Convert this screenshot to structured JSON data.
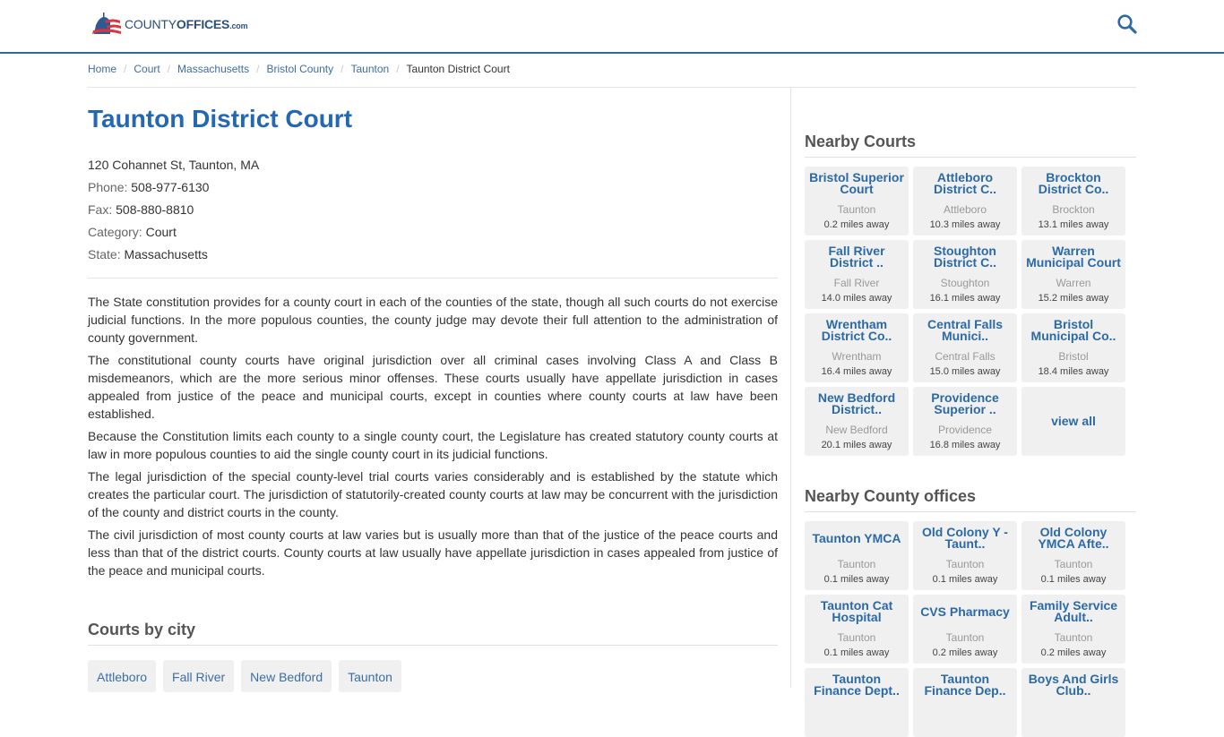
{
  "header": {
    "logo": {
      "county": "COUNTY",
      "offices": "OFFICES",
      "tld": ".com"
    },
    "search_icon": "search-icon"
  },
  "breadcrumb": {
    "items": [
      "Home",
      "Court",
      "Massachusetts",
      "Bristol County",
      "Taunton"
    ],
    "separator": "/",
    "current": "Taunton District Court"
  },
  "page": {
    "title": "Taunton District Court",
    "address": "120 Cohannet St, Taunton, MA",
    "phone_label": "Phone:",
    "phone": "508-977-6130",
    "fax_label": "Fax:",
    "fax": "508-880-8810",
    "category_label": "Category:",
    "category": "Court",
    "state_label": "State:",
    "state": "Massachusetts",
    "paragraphs": [
      "The State constitution provides for a county court in each of the counties of the state, though all such courts do not exercise judicial functions. In the more populous counties, the county judge may devote their full attention to the administration of county government.",
      "The constitutional county courts have original jurisdiction over all criminal cases involving Class A and Class B misdemeanors, which are the more serious minor offenses. These courts usually have appellate jurisdiction in cases appealed from justice of the peace and municipal courts, except in counties where county courts at law have been established.",
      "Because the Constitution limits each county to a single county court, the Legislature has created statutory county courts at law in more populous counties to aid the single county court in its judicial functions.",
      "The legal jurisdiction of the special county-level trial courts varies considerably and is established by the statute which creates the particular court. The jurisdiction of statutorily-created county courts at law may be concurrent with the jurisdiction of the county and district courts in the county.",
      "The civil jurisdiction of most county courts at law varies but is usually more than that of the justice of the peace courts and less than that of the district courts. County courts at law usually have appellate jurisdiction in cases appealed from justice of the peace and municipal courts."
    ]
  },
  "courts_by_city": {
    "heading": "Courts by city",
    "cities": [
      "Attleboro",
      "Fall River",
      "New Bedford",
      "Taunton"
    ]
  },
  "nearby_courts": {
    "heading": "Nearby Courts",
    "items": [
      {
        "name": "Bristol Superior Court",
        "city": "Taunton",
        "distance": "0.2 miles away"
      },
      {
        "name": "Attleboro District C..",
        "city": "Attleboro",
        "distance": "10.3 miles away"
      },
      {
        "name": "Brockton District Co..",
        "city": "Brockton",
        "distance": "13.1 miles away"
      },
      {
        "name": "Fall River District ..",
        "city": "Fall River",
        "distance": "14.0 miles away"
      },
      {
        "name": "Stoughton District C..",
        "city": "Stoughton",
        "distance": "16.1 miles away"
      },
      {
        "name": "Warren Municipal Court",
        "city": "Warren",
        "distance": "15.2 miles away"
      },
      {
        "name": "Wrentham District Co..",
        "city": "Wrentham",
        "distance": "16.4 miles away"
      },
      {
        "name": "Central Falls Munici..",
        "city": "Central Falls",
        "distance": "15.0 miles away"
      },
      {
        "name": "Bristol Municipal Co..",
        "city": "Bristol",
        "distance": "18.4 miles away"
      },
      {
        "name": "New Bedford District..",
        "city": "New Bedford",
        "distance": "20.1 miles away"
      },
      {
        "name": "Providence Superior ..",
        "city": "Providence",
        "distance": "16.8 miles away"
      }
    ],
    "view_all": "view all"
  },
  "nearby_offices": {
    "heading": "Nearby County offices",
    "items": [
      {
        "name": "Taunton YMCA",
        "city": "Taunton",
        "distance": "0.1 miles away"
      },
      {
        "name": "Old Colony Y - Taunt..",
        "city": "Taunton",
        "distance": "0.1 miles away"
      },
      {
        "name": "Old Colony YMCA Afte..",
        "city": "Taunton",
        "distance": "0.1 miles away"
      },
      {
        "name": "Taunton Cat Hospital",
        "city": "Taunton",
        "distance": "0.1 miles away"
      },
      {
        "name": "CVS Pharmacy",
        "city": "Taunton",
        "distance": "0.2 miles away"
      },
      {
        "name": "Family Service Adult..",
        "city": "Taunton",
        "distance": "0.2 miles away"
      },
      {
        "name": "Taunton Finance Dept..",
        "city": "",
        "distance": ""
      },
      {
        "name": "Taunton Finance Dep..",
        "city": "",
        "distance": ""
      },
      {
        "name": "Boys And Girls Club..",
        "city": "",
        "distance": ""
      }
    ]
  },
  "colors": {
    "brand_blue": "#2468b4",
    "link_blue": "#3b6ea5",
    "card_bg": "#f0f0f0",
    "logo_red": "#d9363e"
  }
}
